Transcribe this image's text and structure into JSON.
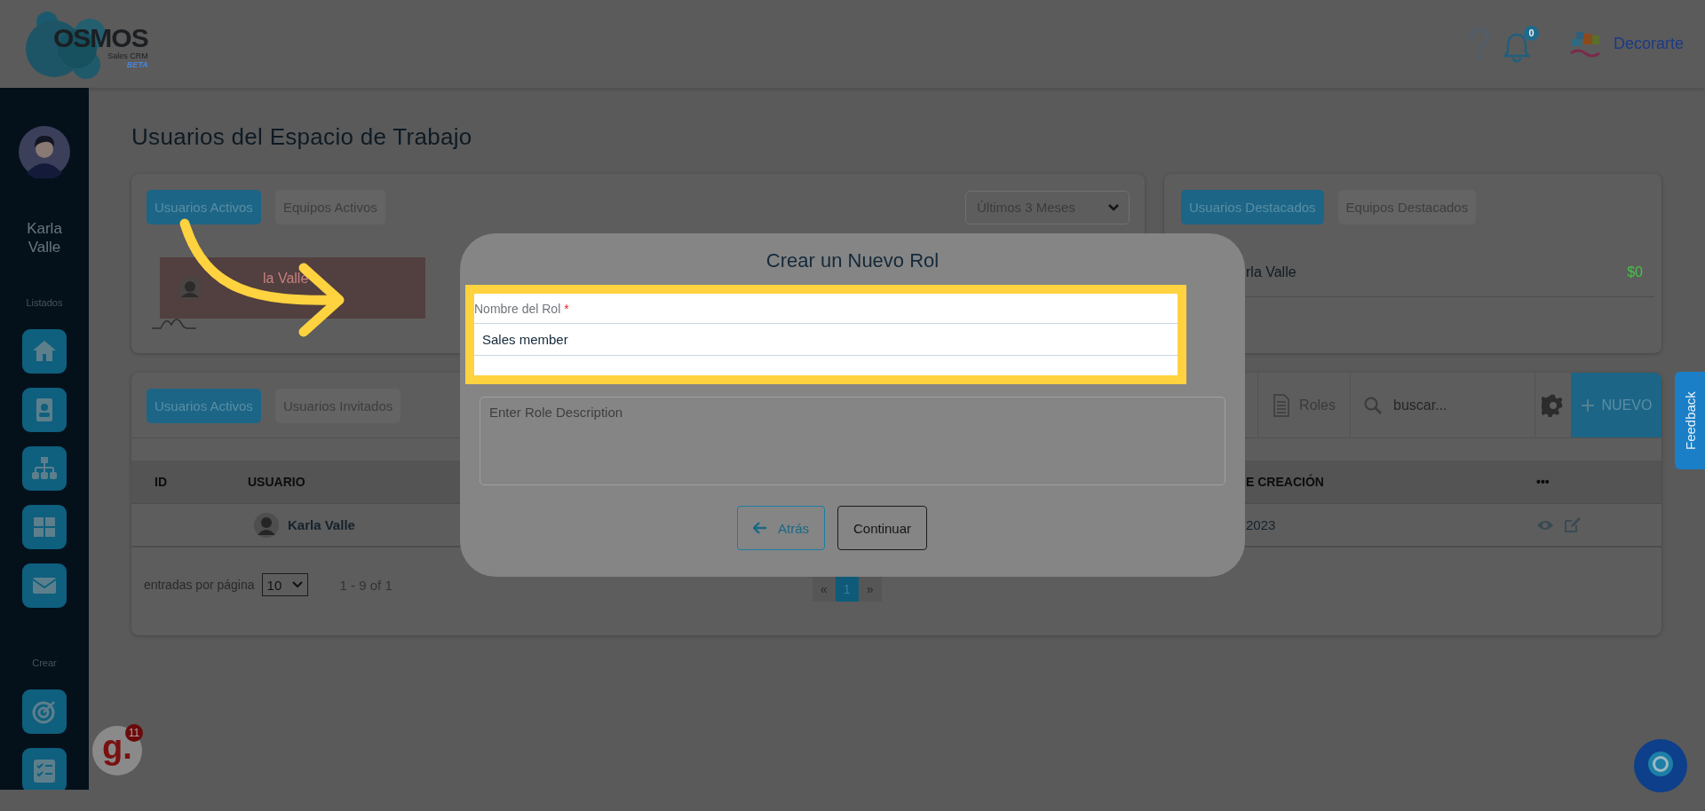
{
  "header": {
    "logo": {
      "name": "OSMOS",
      "subtitle": "Sales CRM",
      "badge": "BETA"
    },
    "notifications": "0",
    "company": "Decorarte"
  },
  "sidebar": {
    "user_name": "Karla Valle",
    "sections": [
      {
        "title": "Listados",
        "items": [
          {
            "kind": "home"
          },
          {
            "kind": "contact"
          },
          {
            "kind": "hierarchy"
          },
          {
            "kind": "grid"
          },
          {
            "kind": "mail"
          }
        ]
      },
      {
        "title": "Crear",
        "items": [
          {
            "kind": "target"
          },
          {
            "kind": "checklist"
          }
        ]
      }
    ]
  },
  "page_title": "Usuarios del Espacio de Trabajo",
  "activity_card": {
    "tabs": [
      {
        "label": "Usuarios Activos",
        "selected": true
      },
      {
        "label": "Equipos Activos",
        "selected": false
      }
    ],
    "period": "Últimos 3 Meses",
    "entries": [
      {
        "name": "la Valle"
      }
    ]
  },
  "featured_card": {
    "tabs": [
      {
        "label": "Usuarios Destacados",
        "selected": true
      },
      {
        "label": "Equipos Destacados",
        "selected": false
      }
    ],
    "rows": [
      {
        "name": "rla Valle",
        "amount": "$0"
      }
    ]
  },
  "users_card": {
    "tabs": [
      {
        "label": "Usuarios Activos",
        "selected": true
      },
      {
        "label": "Usuarios Invitados",
        "selected": false
      }
    ],
    "roles": "Roles",
    "search_placeholder": "buscar...",
    "new_button": "NUEVO",
    "table": {
      "columns": [
        "ID",
        "USUARIO",
        "E CREACIÓN",
        "•••"
      ],
      "rows": [
        {
          "user": "Karla Valle",
          "date": "2023"
        }
      ]
    },
    "page_size_label": "entradas por página",
    "page_size": "10",
    "range": "1 - 9 of 1",
    "pages": [
      {
        "label": "«",
        "selected": false
      },
      {
        "label": "1",
        "selected": true
      },
      {
        "label": "»",
        "selected": false
      }
    ]
  },
  "modal": {
    "title": "Crear un Nuevo Rol",
    "name_field": {
      "label": "Nombre del Rol",
      "required_mark": "*",
      "value": "Sales member"
    },
    "description_field": {
      "placeholder": "Enter Role Description"
    },
    "buttons": [
      {
        "label": "Atrás",
        "kind": "back"
      },
      {
        "label": "Continuar",
        "kind": "primary"
      }
    ]
  },
  "feedback_tab": "Feedback",
  "app_badge": {
    "logo": "g.",
    "count": "11"
  }
}
